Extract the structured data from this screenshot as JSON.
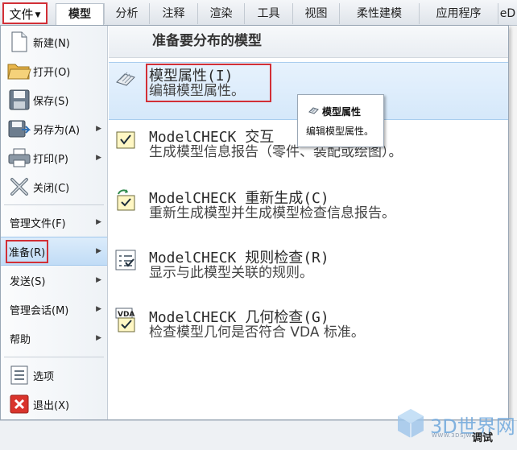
{
  "ribbon": {
    "file_tab": "文件",
    "tabs": [
      "模型",
      "分析",
      "注释",
      "渲染",
      "工具",
      "视图",
      "柔性建模",
      "应用程序",
      "eD"
    ],
    "active_tab": "模型"
  },
  "left_menu": {
    "new": "新建(N)",
    "open": "打开(O)",
    "save": "保存(S)",
    "save_as": "另存为(A)",
    "print": "打印(P)",
    "close": "关闭(C)",
    "manage_file": "管理文件(F)",
    "prepare": "准备(R)",
    "send": "发送(S)",
    "manage_session": "管理会话(M)",
    "help": "帮助",
    "options": "选项",
    "exit": "退出(X)"
  },
  "right_pane": {
    "header": "准备要分布的模型",
    "commands": [
      {
        "title": "模型属性(I)",
        "desc": "编辑模型属性。"
      },
      {
        "title": "ModelCHECK 交互",
        "desc": "生成模型信息报告（零件、装配或绘图）。"
      },
      {
        "title": "ModelCHECK 重新生成(C)",
        "desc": "重新生成模型并生成模型检查信息报告。"
      },
      {
        "title": "ModelCHECK 规则检查(R)",
        "desc": "显示与此模型关联的规则。"
      },
      {
        "title": "ModelCHECK 几何检查(G)",
        "desc": "检查模型几何是否符合 VDA 标准。"
      }
    ]
  },
  "tooltip": {
    "title": "模型属性",
    "desc": "编辑模型属性。"
  },
  "icons": {
    "vda_label": "VDA"
  },
  "status": {
    "debug_label": "调试"
  },
  "watermark": {
    "brand": "3D世界网",
    "url": "WWW.3DSJW.COM"
  },
  "colors": {
    "highlight_red": "#d22f36",
    "selection_blue": "#c1dcf6",
    "accent": "#3b7fc4"
  }
}
